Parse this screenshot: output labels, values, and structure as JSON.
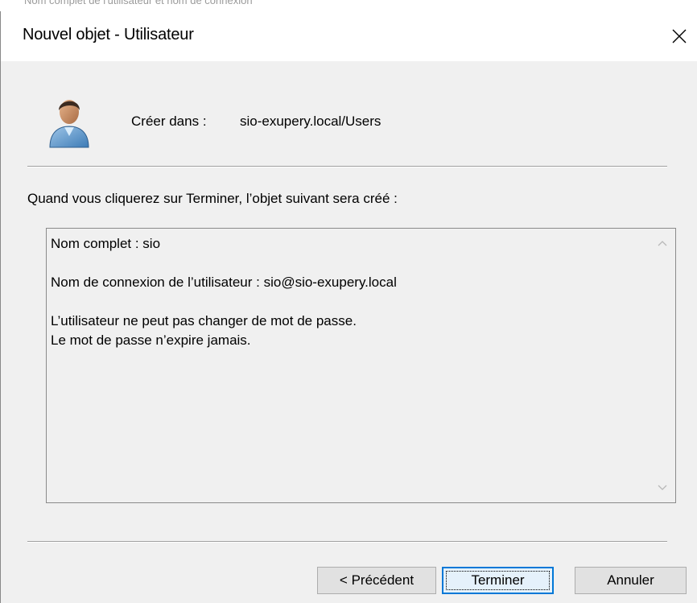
{
  "background": {
    "partial_text": "Nom complet de l'utilisateur et nom de connexion"
  },
  "dialog": {
    "title": "Nouvel objet - Utilisateur",
    "close_icon": "close-icon",
    "user_icon": "user-icon"
  },
  "create_in": {
    "label": "Créer dans :",
    "value": "sio-exupery.local/Users"
  },
  "instructions": "Quand vous cliquerez sur Terminer, l’objet suivant sera créé :",
  "summary": {
    "lines": [
      "Nom complet : sio",
      "",
      "Nom de connexion de l’utilisateur : sio@sio-exupery.local",
      "",
      "L’utilisateur ne peut pas changer de mot de passe.",
      "Le mot de passe n’expire jamais."
    ]
  },
  "buttons": {
    "previous": "< Précédent",
    "finish": "Terminer",
    "cancel": "Annuler"
  },
  "colors": {
    "window_bg": "#f0f0f0",
    "titlebar_bg": "#ffffff",
    "default_button_border": "#0078d7"
  }
}
